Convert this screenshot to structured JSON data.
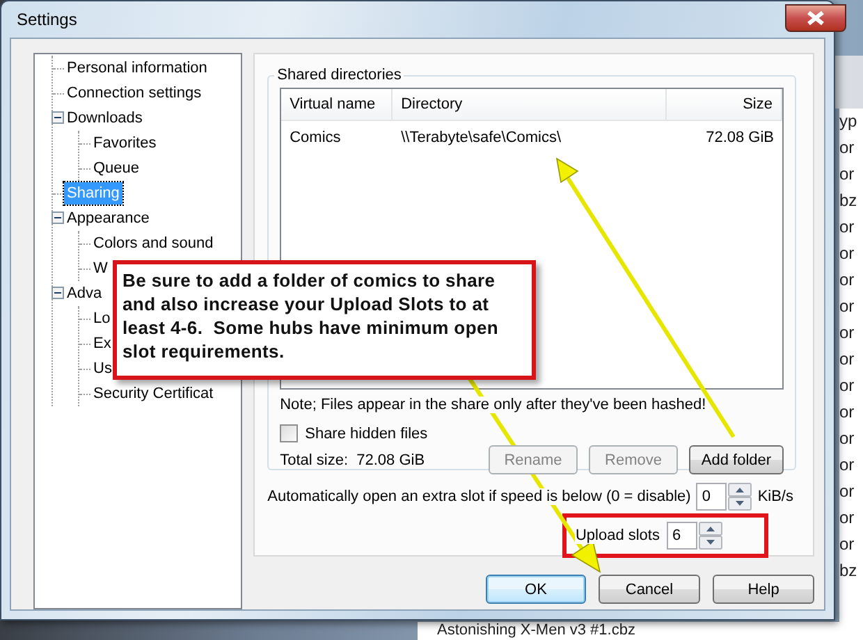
{
  "window": {
    "title": "Settings"
  },
  "backdrop": {
    "side_column": [
      "yp",
      "or",
      "or",
      "bz",
      "or",
      "or",
      "or",
      "or",
      "or",
      "or",
      "or",
      "or",
      "or",
      "or",
      "or",
      "or",
      "or",
      "bz"
    ],
    "bottom_item": "Astonishing X-Men v3 #1.cbz"
  },
  "tree": [
    {
      "label": "Personal information",
      "selected": false
    },
    {
      "label": "Connection settings",
      "selected": false
    },
    {
      "label": "Downloads",
      "selected": false,
      "expanded": true,
      "children": [
        {
          "label": "Favorites",
          "selected": false
        },
        {
          "label": "Queue",
          "selected": false
        }
      ]
    },
    {
      "label": "Sharing",
      "selected": true
    },
    {
      "label": "Appearance",
      "selected": false,
      "expanded": true,
      "children": [
        {
          "label": "Colors and sound",
          "selected": false
        },
        {
          "label": "W",
          "selected": false
        }
      ]
    },
    {
      "label": "Adva",
      "selected": false,
      "expanded": true,
      "children": [
        {
          "label": "Lo",
          "selected": false
        },
        {
          "label": "Ex",
          "selected": false
        },
        {
          "label": "Us",
          "selected": false
        },
        {
          "label": "Security Certificat",
          "selected": false
        }
      ]
    }
  ],
  "shared_directories": {
    "title": "Shared directories",
    "columns": [
      "Virtual name",
      "Directory",
      "Size"
    ],
    "rows": [
      [
        "Comics",
        "\\\\Terabyte\\safe\\Comics\\",
        "72.08 GiB"
      ]
    ],
    "note": "Note; Files appear in the share only after they've been hashed!",
    "share_hidden": {
      "label": "Share hidden files",
      "checked": false
    },
    "total_size": "Total size:  72.08 GiB",
    "buttons": [
      {
        "label": "Rename",
        "disabled": true
      },
      {
        "label": "Remove",
        "disabled": true
      },
      {
        "label": "Add folder",
        "disabled": false
      }
    ]
  },
  "extra_slot": {
    "label": "Automatically open an extra slot if speed is below (0 = disable)",
    "value": "0",
    "unit": "KiB/s"
  },
  "upload_slots": {
    "label": "Upload slots",
    "value": "6",
    "highlighted": true
  },
  "callout": {
    "text": "Be sure to add a folder of comics to share and also increase your Upload Slots to at least 4-6.  Some hubs have minimum open slot requirements."
  },
  "buttons": [
    {
      "label": "OK",
      "default": true
    },
    {
      "label": "Cancel",
      "default": false
    },
    {
      "label": "Help",
      "default": false
    }
  ]
}
